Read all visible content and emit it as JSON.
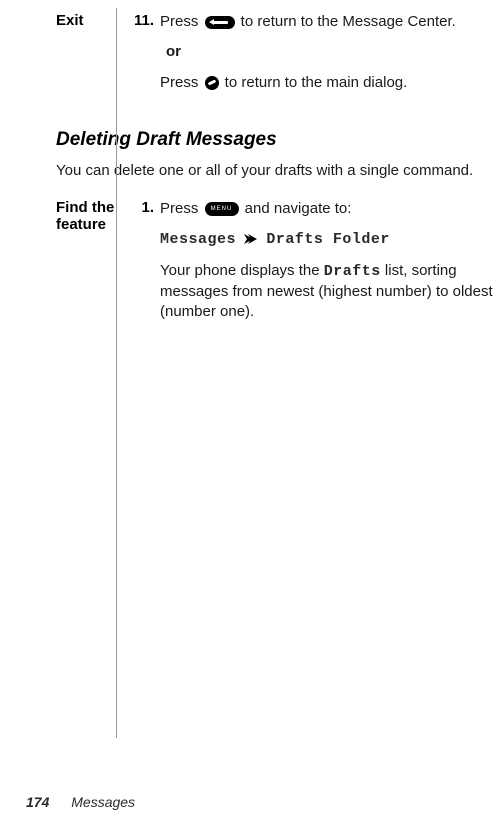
{
  "exit": {
    "label": "Exit",
    "num": "11.",
    "line1a": "Press ",
    "line1b": " to return to the Message Center.",
    "or": "or",
    "line2a": "Press ",
    "line2b": " to return to the main dialog."
  },
  "section": {
    "title": "Deleting Draft Messages",
    "intro": "You can delete one or all of your drafts with a single command."
  },
  "find": {
    "label_l1": "Find the",
    "label_l2": "feature",
    "num": "1.",
    "line1a": "Press ",
    "line1b": " and navigate to:",
    "path1": "Messages",
    "path2": "Drafts Folder",
    "body_a": "Your phone displays the ",
    "body_drafts": "Drafts",
    "body_b": " list, sorting messages from newest (highest number) to oldest (number one).",
    "menu_key_label": "MENU"
  },
  "footer": {
    "page": "174",
    "chapter": "Messages"
  }
}
